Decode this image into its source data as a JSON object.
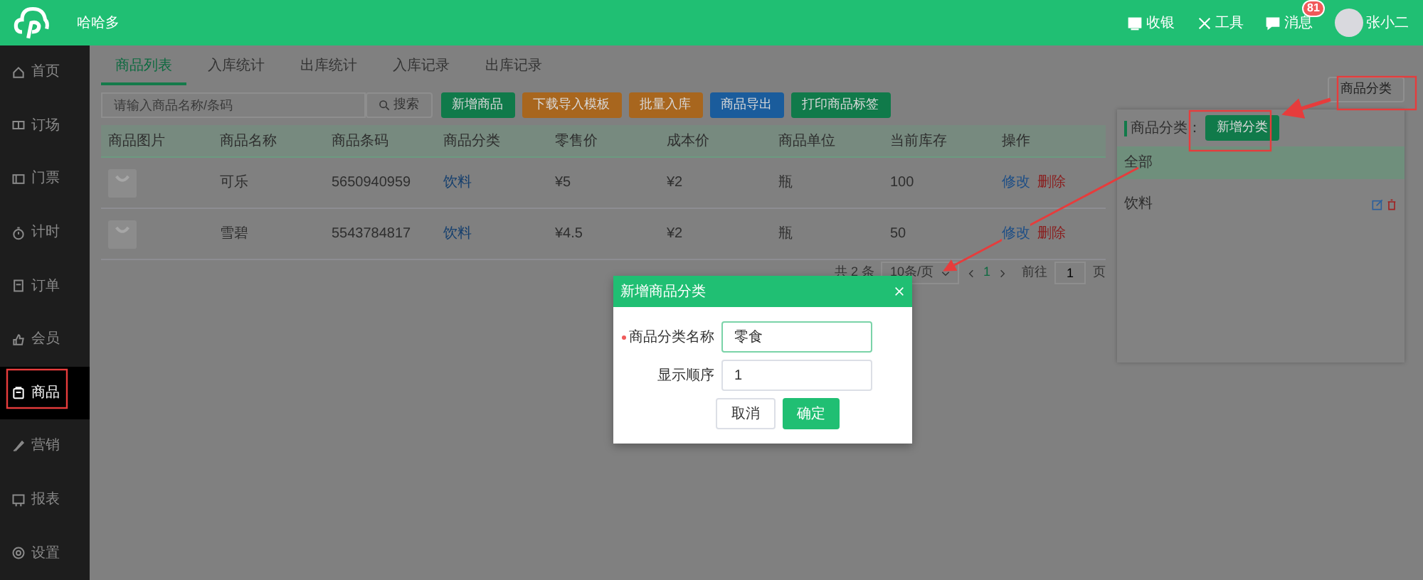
{
  "header": {
    "brand": "哈哈多",
    "actions": [
      {
        "kind": "cashier",
        "label": "收银"
      },
      {
        "kind": "tools",
        "label": "工具"
      },
      {
        "kind": "messages",
        "label": "消息",
        "badge": "81"
      }
    ],
    "user": "张小二"
  },
  "sidebar": {
    "items": [
      {
        "label": "首页",
        "kind": "home",
        "selected": false
      },
      {
        "label": "订场",
        "kind": "court",
        "selected": false
      },
      {
        "label": "门票",
        "kind": "ticket",
        "selected": false
      },
      {
        "label": "计时",
        "kind": "timer",
        "selected": false
      },
      {
        "label": "订单",
        "kind": "order",
        "selected": false
      },
      {
        "label": "会员",
        "kind": "member",
        "selected": false
      },
      {
        "label": "商品",
        "kind": "goods",
        "selected": true
      },
      {
        "label": "营销",
        "kind": "marketing",
        "selected": false
      },
      {
        "label": "报表",
        "kind": "report",
        "selected": false
      },
      {
        "label": "设置",
        "kind": "settings",
        "selected": false
      }
    ]
  },
  "tabs": [
    {
      "label": "商品列表",
      "selected": true
    },
    {
      "label": "入库统计",
      "selected": false
    },
    {
      "label": "出库统计",
      "selected": false
    },
    {
      "label": "入库记录",
      "selected": false
    },
    {
      "label": "出库记录",
      "selected": false
    }
  ],
  "search": {
    "placeholder": "请输入商品名称/条码",
    "button": "搜索"
  },
  "toolbar": [
    {
      "label": "新增商品",
      "color": "#107a4a"
    },
    {
      "label": "下载导入模板",
      "color": "#a8661e"
    },
    {
      "label": "批量入库",
      "color": "#a8661e"
    },
    {
      "label": "商品导出",
      "color": "#1a5c9c"
    },
    {
      "label": "打印商品标签",
      "color": "#107a4a"
    }
  ],
  "category_button": "商品分类",
  "table": {
    "columns": [
      "商品图片",
      "商品名称",
      "商品条码",
      "商品分类",
      "零售价",
      "成本价",
      "商品单位",
      "当前库存",
      "操作"
    ],
    "rows": [
      {
        "cells": [
          "",
          "可乐",
          "5650940959",
          "饮料",
          "¥5",
          "¥2",
          "瓶",
          "100"
        ],
        "actions": [
          "修改",
          "删除"
        ]
      },
      {
        "cells": [
          "",
          "雪碧",
          "5543784817",
          "饮料",
          "¥4.5",
          "¥2",
          "瓶",
          "50"
        ],
        "actions": [
          "修改",
          "删除"
        ]
      }
    ]
  },
  "pagination": {
    "total": "共 2 条",
    "page_size": "10条/页",
    "pages": [
      {
        "label": "1",
        "selected": true
      }
    ],
    "goto_label": "前往",
    "goto_value": "1",
    "page_suffix": "页"
  },
  "category_panel": {
    "title": "商品分类：",
    "add_button": "新增分类",
    "items": [
      {
        "label": "全部",
        "selected": true,
        "editable": false
      },
      {
        "label": "饮料",
        "selected": false,
        "editable": true
      }
    ]
  },
  "modal": {
    "title": "新增商品分类",
    "fields": [
      {
        "label": "商品分类名称",
        "required": true,
        "value": "零食",
        "focused": true
      },
      {
        "label": "显示顺序",
        "required": false,
        "value": "1",
        "focused": false
      }
    ],
    "buttons": [
      {
        "label": "取消",
        "kind": "default"
      },
      {
        "label": "确定",
        "kind": "primary"
      }
    ]
  }
}
